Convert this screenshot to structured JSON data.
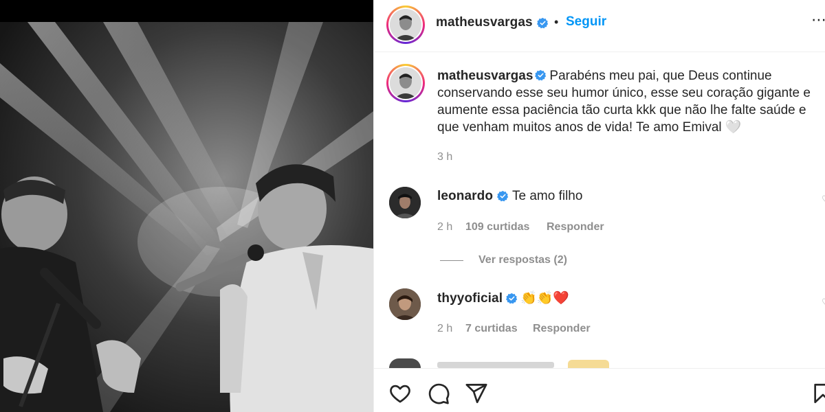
{
  "post": {
    "author": "matheusvargas",
    "follow_label": "Seguir",
    "separator": "•",
    "more_glyph": "⋯",
    "caption": "Parabéns meu pai, que Deus continue conservando esse seu humor único, esse seu coração gigante e aumente essa paciência tão curta kkk que não lhe falte saúde e que venham muitos anos de vida! Te amo Emival 🤍",
    "caption_time": "3 h"
  },
  "comments": [
    {
      "user": "leonardo",
      "text": "Te amo filho",
      "time": "2 h",
      "likes": "109 curtidas",
      "reply_label": "Responder",
      "view_replies": "Ver respostas (2)"
    },
    {
      "user": "thyyoficial",
      "text": "👏👏❤️",
      "time": "2 h",
      "likes": "7 curtidas",
      "reply_label": "Responder"
    }
  ],
  "actions": [
    "heart-icon",
    "comment-icon",
    "share-icon",
    "bookmark-icon"
  ],
  "colors": {
    "accent": "#0095f6",
    "verified": "#3897f0",
    "muted": "#8e8e8e",
    "text": "#262626"
  }
}
